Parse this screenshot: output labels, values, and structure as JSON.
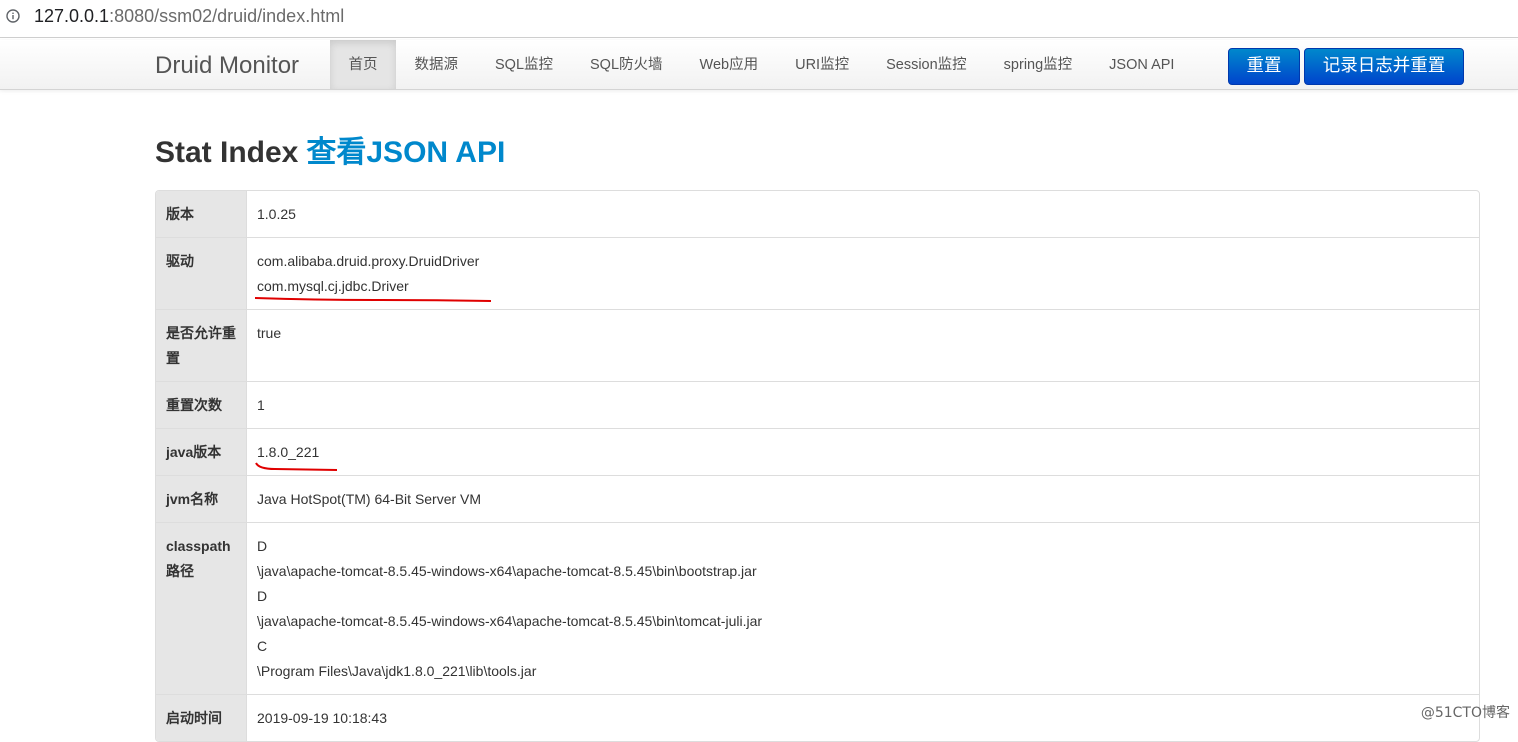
{
  "browser": {
    "url_host": "127.0.0.1",
    "url_rest": ":8080/ssm02/druid/index.html",
    "icon": "info-icon"
  },
  "navbar": {
    "brand": "Druid Monitor",
    "items": [
      "首页",
      "数据源",
      "SQL监控",
      "SQL防火墙",
      "Web应用",
      "URI监控",
      "Session监控",
      "spring监控",
      "JSON API"
    ],
    "active_index": 0,
    "reset_label": "重置",
    "log_reset_label": "记录日志并重置",
    "accent_color": "#0088cc"
  },
  "page": {
    "title": "Stat Index",
    "json_link": "查看JSON API"
  },
  "stats": {
    "version": {
      "key": "版本",
      "value": "1.0.25"
    },
    "driver": {
      "key": "驱动",
      "values": [
        "com.alibaba.druid.proxy.DruidDriver",
        "com.mysql.cj.jdbc.Driver"
      ]
    },
    "reset_enable": {
      "key": "是否允许重置",
      "value": "true"
    },
    "reset_count": {
      "key": "重置次数",
      "value": "1"
    },
    "java_version": {
      "key": "java版本",
      "value": "1.8.0_221"
    },
    "jvm_name": {
      "key": "jvm名称",
      "value": "Java HotSpot(TM) 64-Bit Server VM"
    },
    "classpath": {
      "key": "classpath路径",
      "values": [
        "D",
        "\\java\\apache-tomcat-8.5.45-windows-x64\\apache-tomcat-8.5.45\\bin\\bootstrap.jar",
        "D",
        "\\java\\apache-tomcat-8.5.45-windows-x64\\apache-tomcat-8.5.45\\bin\\tomcat-juli.jar",
        "C",
        "\\Program Files\\Java\\jdk1.8.0_221\\lib\\tools.jar"
      ]
    },
    "start_time": {
      "key": "启动时间",
      "value": "2019-09-19 10:18:43"
    }
  },
  "watermark": "@51CTO博客"
}
